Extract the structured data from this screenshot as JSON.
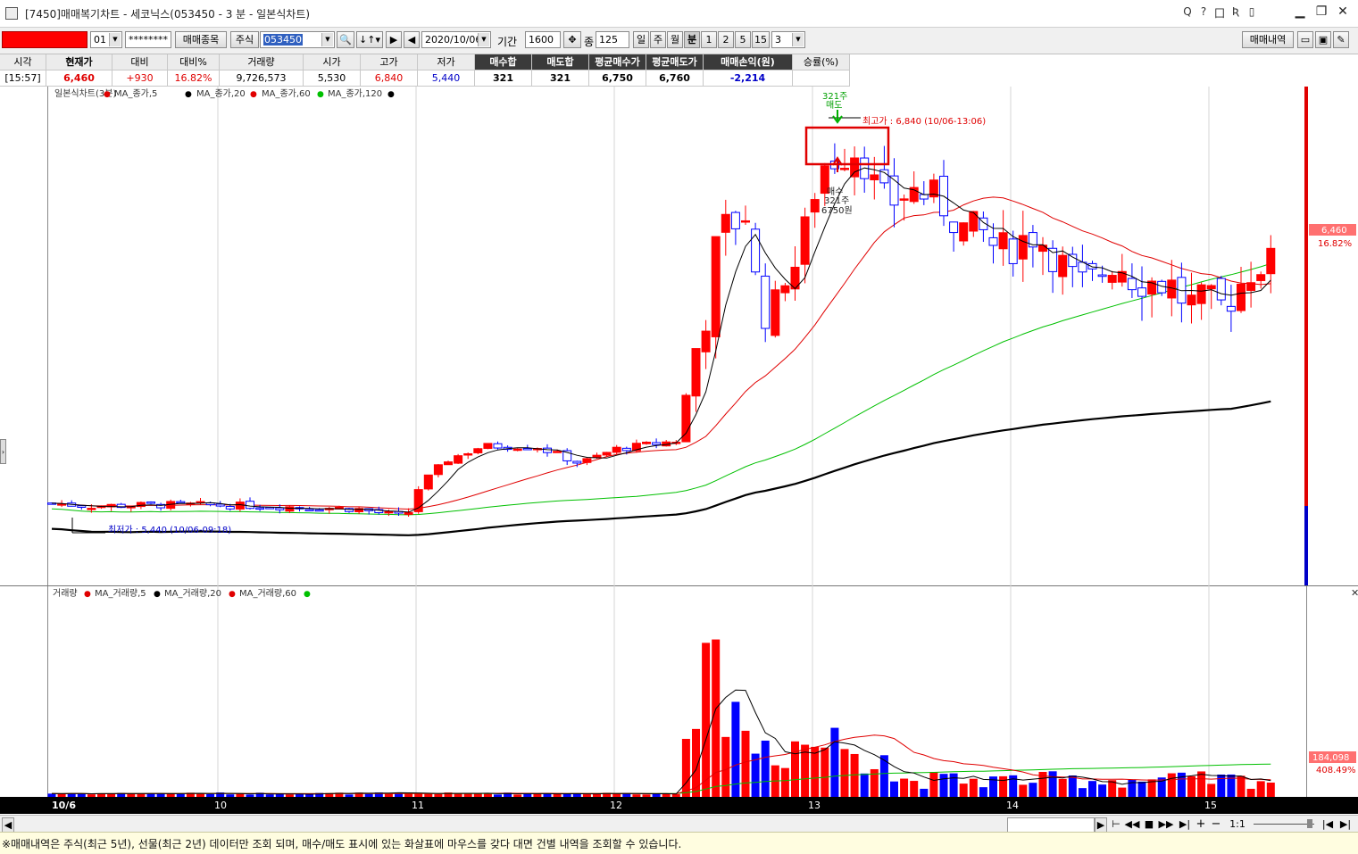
{
  "window": {
    "title": "[7450]매매복기차트 - 세코닉스(053450 - 3 분 - 일본식차트)",
    "controls": [
      "▁",
      "❐",
      "✕"
    ],
    "small_icons": [
      "Q",
      "?",
      "囗",
      "Ʀ",
      "▯"
    ]
  },
  "toolbar": {
    "account_number": "",
    "account_suffix": "01",
    "password": "********",
    "trade_items_btn": "매매종목",
    "market_type": "주식",
    "stock_code": "053450",
    "date": "2020/10/06",
    "period_label": "기간",
    "period_value": "1600",
    "count_label": "종",
    "count_value": "125",
    "period_btns": [
      "일",
      "주",
      "월",
      "분",
      "1",
      "2",
      "5",
      "15"
    ],
    "minute_value": "3",
    "trade_history_btn": "매매내역"
  },
  "info": {
    "headers": [
      "시각",
      "현재가",
      "대비",
      "대비%",
      "거래량",
      "시가",
      "고가",
      "저가",
      "매수합",
      "매도합",
      "평균매수가",
      "평균매도가",
      "매매손익(원)",
      "승률(%)"
    ],
    "values": [
      "[15:57]",
      "6,460",
      "+930",
      "16.82%",
      "9,726,573",
      "5,530",
      "6,840",
      "5,440",
      "321",
      "321",
      "6,750",
      "6,760",
      "-2,214",
      ""
    ]
  },
  "price_panel": {
    "legend_title": "일본식차트(3분)",
    "legend_items": [
      "MA_종가,5",
      "MA_종가,20",
      "MA_종가,60",
      "MA_종가,120"
    ],
    "high_label": "최고가 : 6,840 (10/06-13:06)",
    "low_label": "최저가 : 5,440 (10/06-09:18)",
    "sell_marker": [
      "321주",
      "매도"
    ],
    "buy_marker": [
      "매수",
      "321주",
      "6750원"
    ],
    "current_price_tag": "6,460",
    "current_pct_tag": "16.82%"
  },
  "volume_panel": {
    "legend_title": "거래량",
    "legend_items": [
      "MA_거래량,5",
      "MA_거래량,20",
      "MA_거래량,60"
    ],
    "current_volume_tag": "184,098",
    "current_pct_tag": "408.49%"
  },
  "xaxis_labels": [
    "10/6",
    "10",
    "11",
    "12",
    "13",
    "14",
    "15"
  ],
  "scroll": {
    "zoom": "1:1"
  },
  "notice": "※매매내역은 주식(최근 5년), 선물(최근 2년) 데이터만 조회 되며, 매수/매도 표시에 있는 화살표에 마우스를 갖다 대면 건별 내역을 조회할 수 있습니다.",
  "colors": {
    "up": "#ff0000",
    "down": "#0000ff",
    "ma5": "#000000",
    "ma20": "#e00000",
    "ma60": "#00c000",
    "ma120": "#000000"
  }
}
